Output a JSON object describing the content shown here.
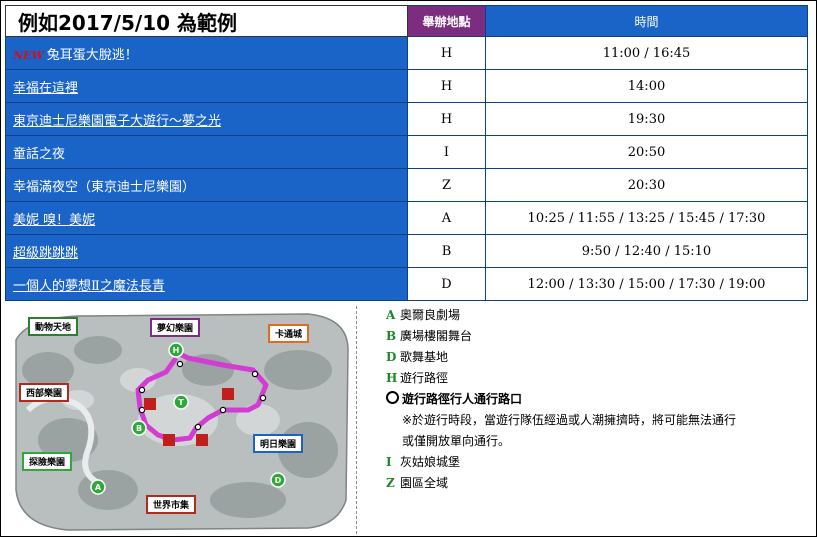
{
  "header": {
    "example_title": "例如2017/5/10 為範例",
    "location_col": "舉辦地點",
    "time_col": "時間"
  },
  "new_tag": "NEW",
  "events": [
    {
      "name": "兔耳蛋大脫逃！",
      "location": "H",
      "times": "11:00 / 16:45",
      "link": false,
      "is_new": true
    },
    {
      "name": "幸福在這裡",
      "location": "H",
      "times": "14:00",
      "link": true,
      "is_new": false
    },
    {
      "name": "東京迪士尼樂園電子大遊行～夢之光",
      "location": "H",
      "times": "19:30",
      "link": true,
      "is_new": false
    },
    {
      "name": "童話之夜",
      "location": "I",
      "times": "20:50",
      "link": false,
      "is_new": false
    },
    {
      "name": "幸福滿夜空（東京迪士尼樂園）",
      "location": "Z",
      "times": "20:30",
      "link": false,
      "is_new": false
    },
    {
      "name": "美妮 嗅！美妮",
      "location": "A",
      "times": "10:25 / 11:55 / 13:25 / 15:45 / 17:30",
      "link": true,
      "is_new": false
    },
    {
      "name": "超級跳跳跳",
      "location": "B",
      "times": "9:50 / 12:40 / 15:10",
      "link": true,
      "is_new": false
    },
    {
      "name": "一個人的夢想Ⅱ之魔法長青",
      "location": "D",
      "times": "12:00 / 13:30 / 15:00 / 17:30 / 19:00",
      "link": true,
      "is_new": false
    }
  ],
  "map": {
    "areas": {
      "adventure": "探險樂園",
      "western": "西部樂園",
      "critter": "動物天地",
      "fantasy": "夢幻樂園",
      "toontown": "卡通城",
      "tomorrow": "明日樂園",
      "bazaar": "世界市集"
    },
    "markers": {
      "h": "H",
      "t": "T",
      "b": "B",
      "a": "A",
      "d": "D"
    },
    "colors": {
      "parade_route": "#d23cd2",
      "marker_green": "#2fa83a"
    }
  },
  "legend": {
    "a": {
      "key": "A",
      "text": "奧爾良劇場"
    },
    "b": {
      "key": "B",
      "text": "廣場樓閣舞台"
    },
    "d": {
      "key": "D",
      "text": "歌舞基地"
    },
    "h": {
      "key": "H",
      "text": "遊行路徑"
    },
    "crossing": {
      "text": "遊行路徑行人通行路口"
    },
    "note_line1": "※於遊行時段，當遊行隊伍經過或人潮擁擠時，將可能無法通行",
    "note_line2": "或僅開放單向通行。",
    "i": {
      "key": "I",
      "text": "灰姑娘城堡"
    },
    "z": {
      "key": "Z",
      "text": "園區全域"
    }
  }
}
